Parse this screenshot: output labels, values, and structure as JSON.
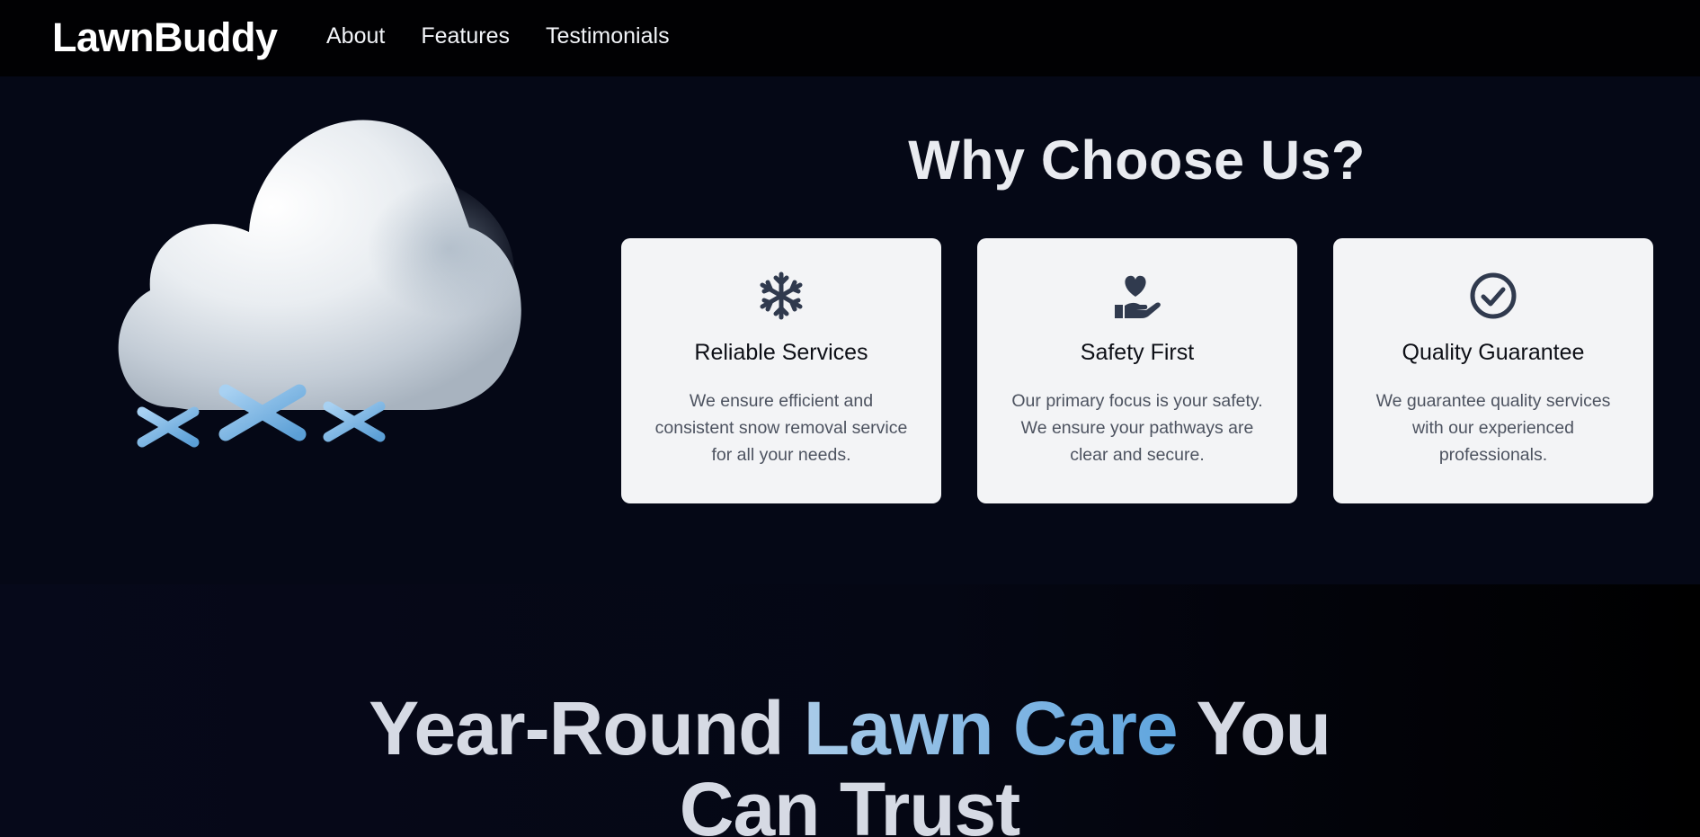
{
  "header": {
    "brand": "LawnBuddy",
    "nav": [
      {
        "label": "About"
      },
      {
        "label": "Features"
      },
      {
        "label": "Testimonials"
      }
    ]
  },
  "features": {
    "title": "Why Choose Us?",
    "cards": [
      {
        "icon": "snowflake-icon",
        "title": "Reliable Services",
        "text": "We ensure efficient and consistent snow removal service for all your needs."
      },
      {
        "icon": "hand-holding-heart-icon",
        "title": "Safety First",
        "text": "Our primary focus is your safety. We ensure your pathways are clear and secure."
      },
      {
        "icon": "check-circle-icon",
        "title": "Quality Guarantee",
        "text": "We guarantee quality services with our experienced professionals."
      }
    ]
  },
  "hero": {
    "title_part1": "Year-Round",
    "title_accent": "Lawn Care",
    "title_part2": "You",
    "title_line2": "Can Trust"
  },
  "colors": {
    "accent": "#7eb6e6",
    "dark_bg": "#050816",
    "card_bg": "#f3f4f6",
    "icon": "#303a4e"
  }
}
